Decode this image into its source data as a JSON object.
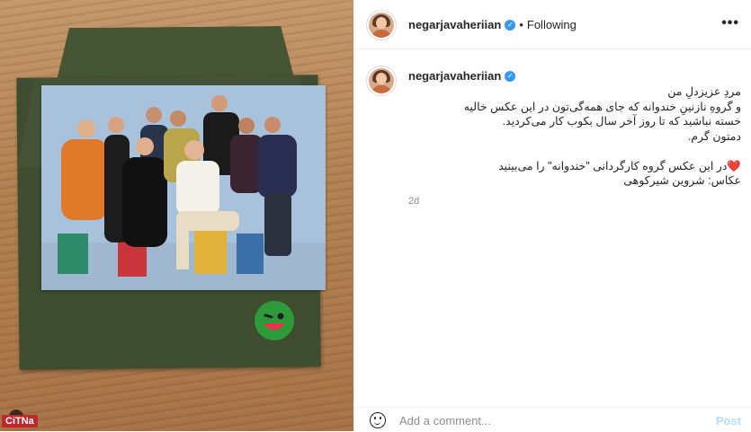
{
  "header": {
    "username": "negarjavaheriian",
    "separator": "•",
    "follow_status": "Following",
    "more_icon": "more-horizontal-icon"
  },
  "caption": {
    "username": "negarjavaheriian",
    "text": "مردِ عزیزدلِ من\nو گروهِ نازنینِ خندوانه که جای همه‌گی‌تون در این عکس خالیه\nخسته نباشید که تا روز آخر سال بکوب کار می‌کردید.\nدمتون گرم.\n\n❤️در این عکس گروه کارگردانی \"خندوانه\" را می‌بینید\nعکاس: شروین شیرکوهی",
    "timestamp": "2d"
  },
  "comment": {
    "placeholder": "Add a comment...",
    "post_label": "Post",
    "emoji_icon": "smiley-icon"
  },
  "watermark": {
    "text": "CiTNa"
  },
  "colors": {
    "verified": "#3897f0",
    "post_disabled": "#b2dffc",
    "envelope": "#3e4c2f",
    "wood": "#b98957"
  }
}
